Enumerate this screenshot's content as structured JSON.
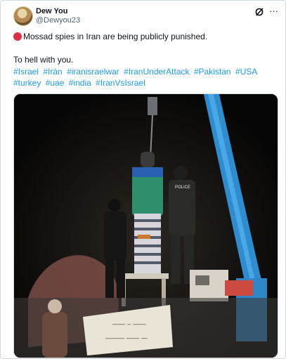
{
  "author": {
    "display_name": "Dew You",
    "handle": "@Dewyou23",
    "avatar_icon": "avatar"
  },
  "header_icons": [
    "grok-icon",
    "more-icon"
  ],
  "more_label": "···",
  "post": {
    "line1": "Mossad spies in Iran are being publicly punished.",
    "line2": "To hell with you.",
    "hashtags": [
      "#Israel",
      "#Irán",
      "#iranisraelwar",
      "#IranUnderAttack",
      "#Pakistan",
      "#USA",
      "#turkey",
      "#uae",
      "#india",
      "#IranVsIsrael"
    ],
    "emoji_icon": "red-circle-icon"
  },
  "media": {
    "uniform_label": "POLICE",
    "banner_text": "…"
  }
}
